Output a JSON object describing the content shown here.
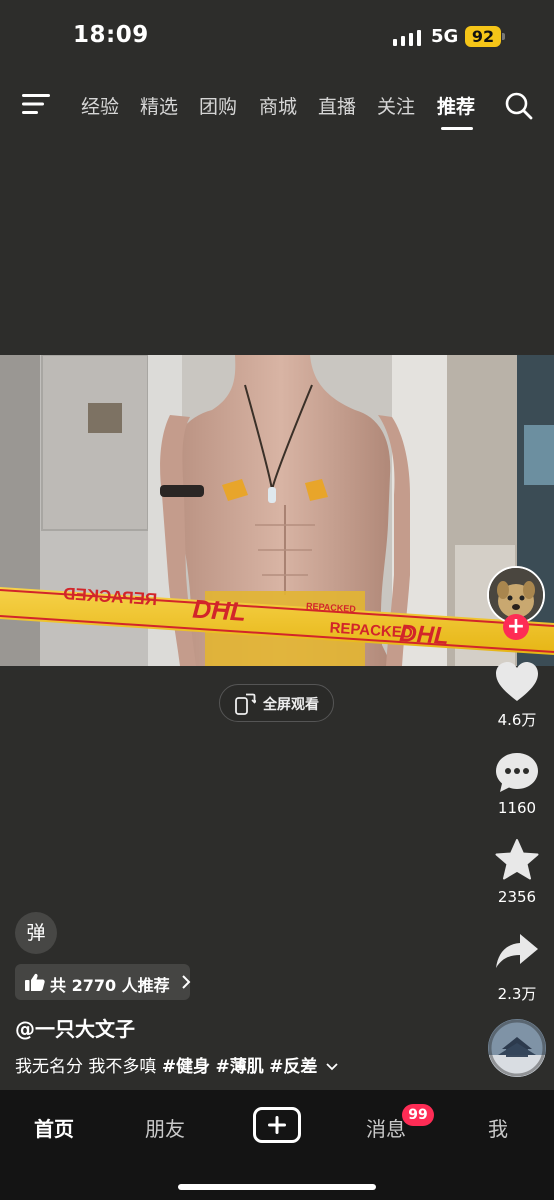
{
  "status": {
    "time": "18:09",
    "network": "5G",
    "battery": "92"
  },
  "topnav": {
    "tabs": [
      "经验",
      "精选",
      "团购",
      "商城",
      "直播",
      "关注",
      "推荐"
    ],
    "active_tab": "推荐"
  },
  "video": {
    "tape_text_left": "REPACKED",
    "tape_logo": "DHL",
    "tape_text_mid": "REPACKED",
    "tape_logo_2": "DHL",
    "tape_text_small": "REPACKED"
  },
  "fullscreen_label": "全屏观看",
  "rail": {
    "likes": "4.6万",
    "comments": "1160",
    "favorites": "2356",
    "shares": "2.3万"
  },
  "post": {
    "danmu_label": "弹",
    "recommend_text": "共 2770 人推荐",
    "author": "@一只大文子",
    "caption": "我无名分 我不多嗔",
    "tags": [
      "#健身",
      "#薄肌",
      "#反差"
    ]
  },
  "bottom_nav": {
    "home": "首页",
    "friends": "朋友",
    "messages": "消息",
    "me": "我",
    "message_badge": "99"
  },
  "colors": {
    "background": "#2d2d2b",
    "accent": "#fe2c55",
    "battery": "#f5c518",
    "tape": "#f2c318"
  }
}
